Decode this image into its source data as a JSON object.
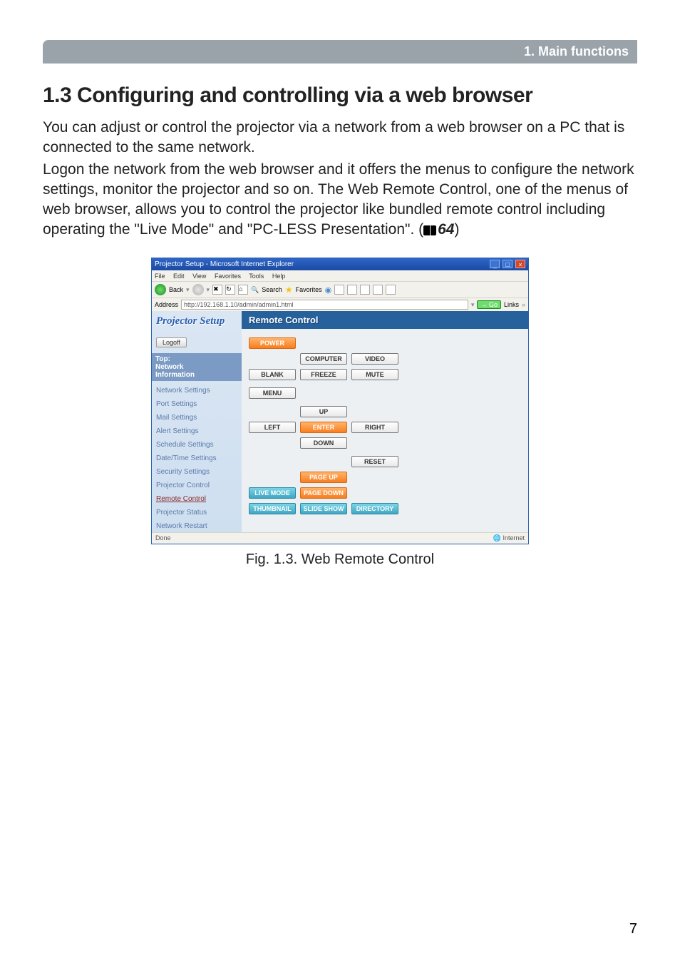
{
  "section_bar": "1. Main functions",
  "heading": "1.3 Configuring and controlling via a web browser",
  "para1": "You can adjust or control the projector via a network from a web browser on a PC that is connected to the same network.",
  "para2a": "Logon the network from the web browser and it offers the menus to configure the network settings, monitor the projector and so on. The Web Remote Control, one of the menus of web browser, allows you to control the projector like bundled remote control including operating the \"Live Mode\" and \"PC-LESS Presentation\". (",
  "ref_num": "64",
  "para2b": ")",
  "fig_caption": "Fig. 1.3. Web Remote Control",
  "page_number": "7",
  "ie": {
    "title": "Projector Setup - Microsoft Internet Explorer",
    "menu": [
      "File",
      "Edit",
      "View",
      "Favorites",
      "Tools",
      "Help"
    ],
    "toolbar": {
      "back": "Back",
      "search": "Search",
      "favorites": "Favorites"
    },
    "address_label": "Address",
    "address_value": "http://192.168.1.10/admin/admin1.html",
    "go": "Go",
    "links": "Links",
    "status_left": "Done",
    "status_right": "Internet"
  },
  "sidebar": {
    "title": "Projector Setup",
    "logoff": "Logoff",
    "head_top": "Top:",
    "head_l2": "Network",
    "head_l3": "Information",
    "items": [
      {
        "label": "Network Settings"
      },
      {
        "label": "Port Settings"
      },
      {
        "label": "Mail Settings"
      },
      {
        "label": "Alert Settings"
      },
      {
        "label": "Schedule Settings"
      },
      {
        "label": "Date/Time Settings"
      },
      {
        "label": "Security Settings"
      },
      {
        "label": "Projector Control"
      },
      {
        "label": "Remote Control"
      },
      {
        "label": "Projector Status"
      },
      {
        "label": "Network Restart"
      }
    ],
    "active_index": 8
  },
  "panel": {
    "title": "Remote Control",
    "buttons": {
      "power": "POWER",
      "computer": "COMPUTER",
      "video": "VIDEO",
      "blank": "BLANK",
      "freeze": "FREEZE",
      "mute": "MUTE",
      "menu": "MENU",
      "up": "UP",
      "left": "LEFT",
      "enter": "ENTER",
      "right": "RIGHT",
      "down": "DOWN",
      "reset": "RESET",
      "pageup": "PAGE UP",
      "pagedown": "PAGE DOWN",
      "livemode": "LIVE MODE",
      "slideshow": "SLIDE SHOW",
      "thumbnail": "THUMBNAIL",
      "directory": "DIRECTORY"
    }
  }
}
